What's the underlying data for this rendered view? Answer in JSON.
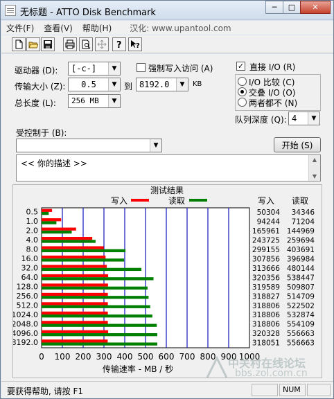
{
  "window": {
    "title": "无标题 - ATTO Disk Benchmark",
    "min_label": "─",
    "max_label": "□",
    "close_label": "✕"
  },
  "menu": {
    "file": "文件(F)",
    "view": "查看(V)",
    "help": "帮助(H)",
    "localized": "汉化: www.upantool.com"
  },
  "toolbar": {
    "icons": [
      "new-icon",
      "open-icon",
      "save-icon",
      "print-icon",
      "print-preview-icon",
      "move-icon",
      "help-icon",
      "context-help-icon"
    ]
  },
  "settings": {
    "drive_label": "驱动器 (D):",
    "drive_value": "[-c-]",
    "force_write_label": "强制写入访问 (A)",
    "force_write_checked": false,
    "transfer_label": "传输大小 (Z):",
    "transfer_from": "0.5",
    "to_label": "到",
    "transfer_to": "8192.0",
    "kb_label": "KB",
    "total_label": "总长度 (L):",
    "total_value": "256 MB",
    "direct_io_label": "直接 I/O (R)",
    "direct_io_checked": true,
    "io_compare_label": "I/O 比较 (C)",
    "overlapped_label": "交叠 I/O (O)",
    "neither_label": "两者都不 (N)",
    "io_mode_selected": "overlapped",
    "queue_label": "队列深度 (Q):",
    "queue_value": "4",
    "controlled_label": "受控制于 (B):",
    "controlled_value": "",
    "start_label": "开始 (S)",
    "description": "<<  你的描述   >>"
  },
  "results": {
    "group_title": "测试结果",
    "write_label": "写入",
    "read_label": "读取",
    "col_write": "写入",
    "col_read": "读取",
    "xlabel": "传输速率 - MB / 秒"
  },
  "colors": {
    "write": "#ff0000",
    "read": "#008000",
    "gridline": "#1010c0"
  },
  "chart_data": {
    "type": "bar",
    "orientation": "horizontal",
    "categories": [
      "0.5",
      "1.0",
      "2.0",
      "4.0",
      "8.0",
      "16.0",
      "32.0",
      "64.0",
      "128.0",
      "256.0",
      "512.0",
      "1024.0",
      "2048.0",
      "4096.0",
      "8192.0"
    ],
    "series": [
      {
        "name": "写入",
        "values": [
          50304,
          94244,
          165961,
          243725,
          299155,
          307856,
          313666,
          320356,
          319589,
          318827,
          318806,
          318806,
          318806,
          320328,
          318051
        ]
      },
      {
        "name": "读取",
        "values": [
          34346,
          71204,
          144969,
          259694,
          403691,
          396984,
          480144,
          538447,
          509807,
          514709,
          522502,
          532874,
          554109,
          556663,
          556663
        ]
      }
    ],
    "x_ticks": [
      "0",
      "100",
      "200",
      "300",
      "400",
      "500",
      "600",
      "700",
      "800",
      "900",
      "1000"
    ],
    "xlim": [
      0,
      1000
    ],
    "xlabel": "传输速率 - MB / 秒",
    "value_unit_divisor": 1000,
    "legend": "top"
  },
  "statusbar": {
    "text": "要获得帮助, 请按 F1",
    "num": "NUM"
  },
  "watermark": {
    "text": "中关村在线论坛",
    "url": "bbs.zol.com.cn"
  }
}
